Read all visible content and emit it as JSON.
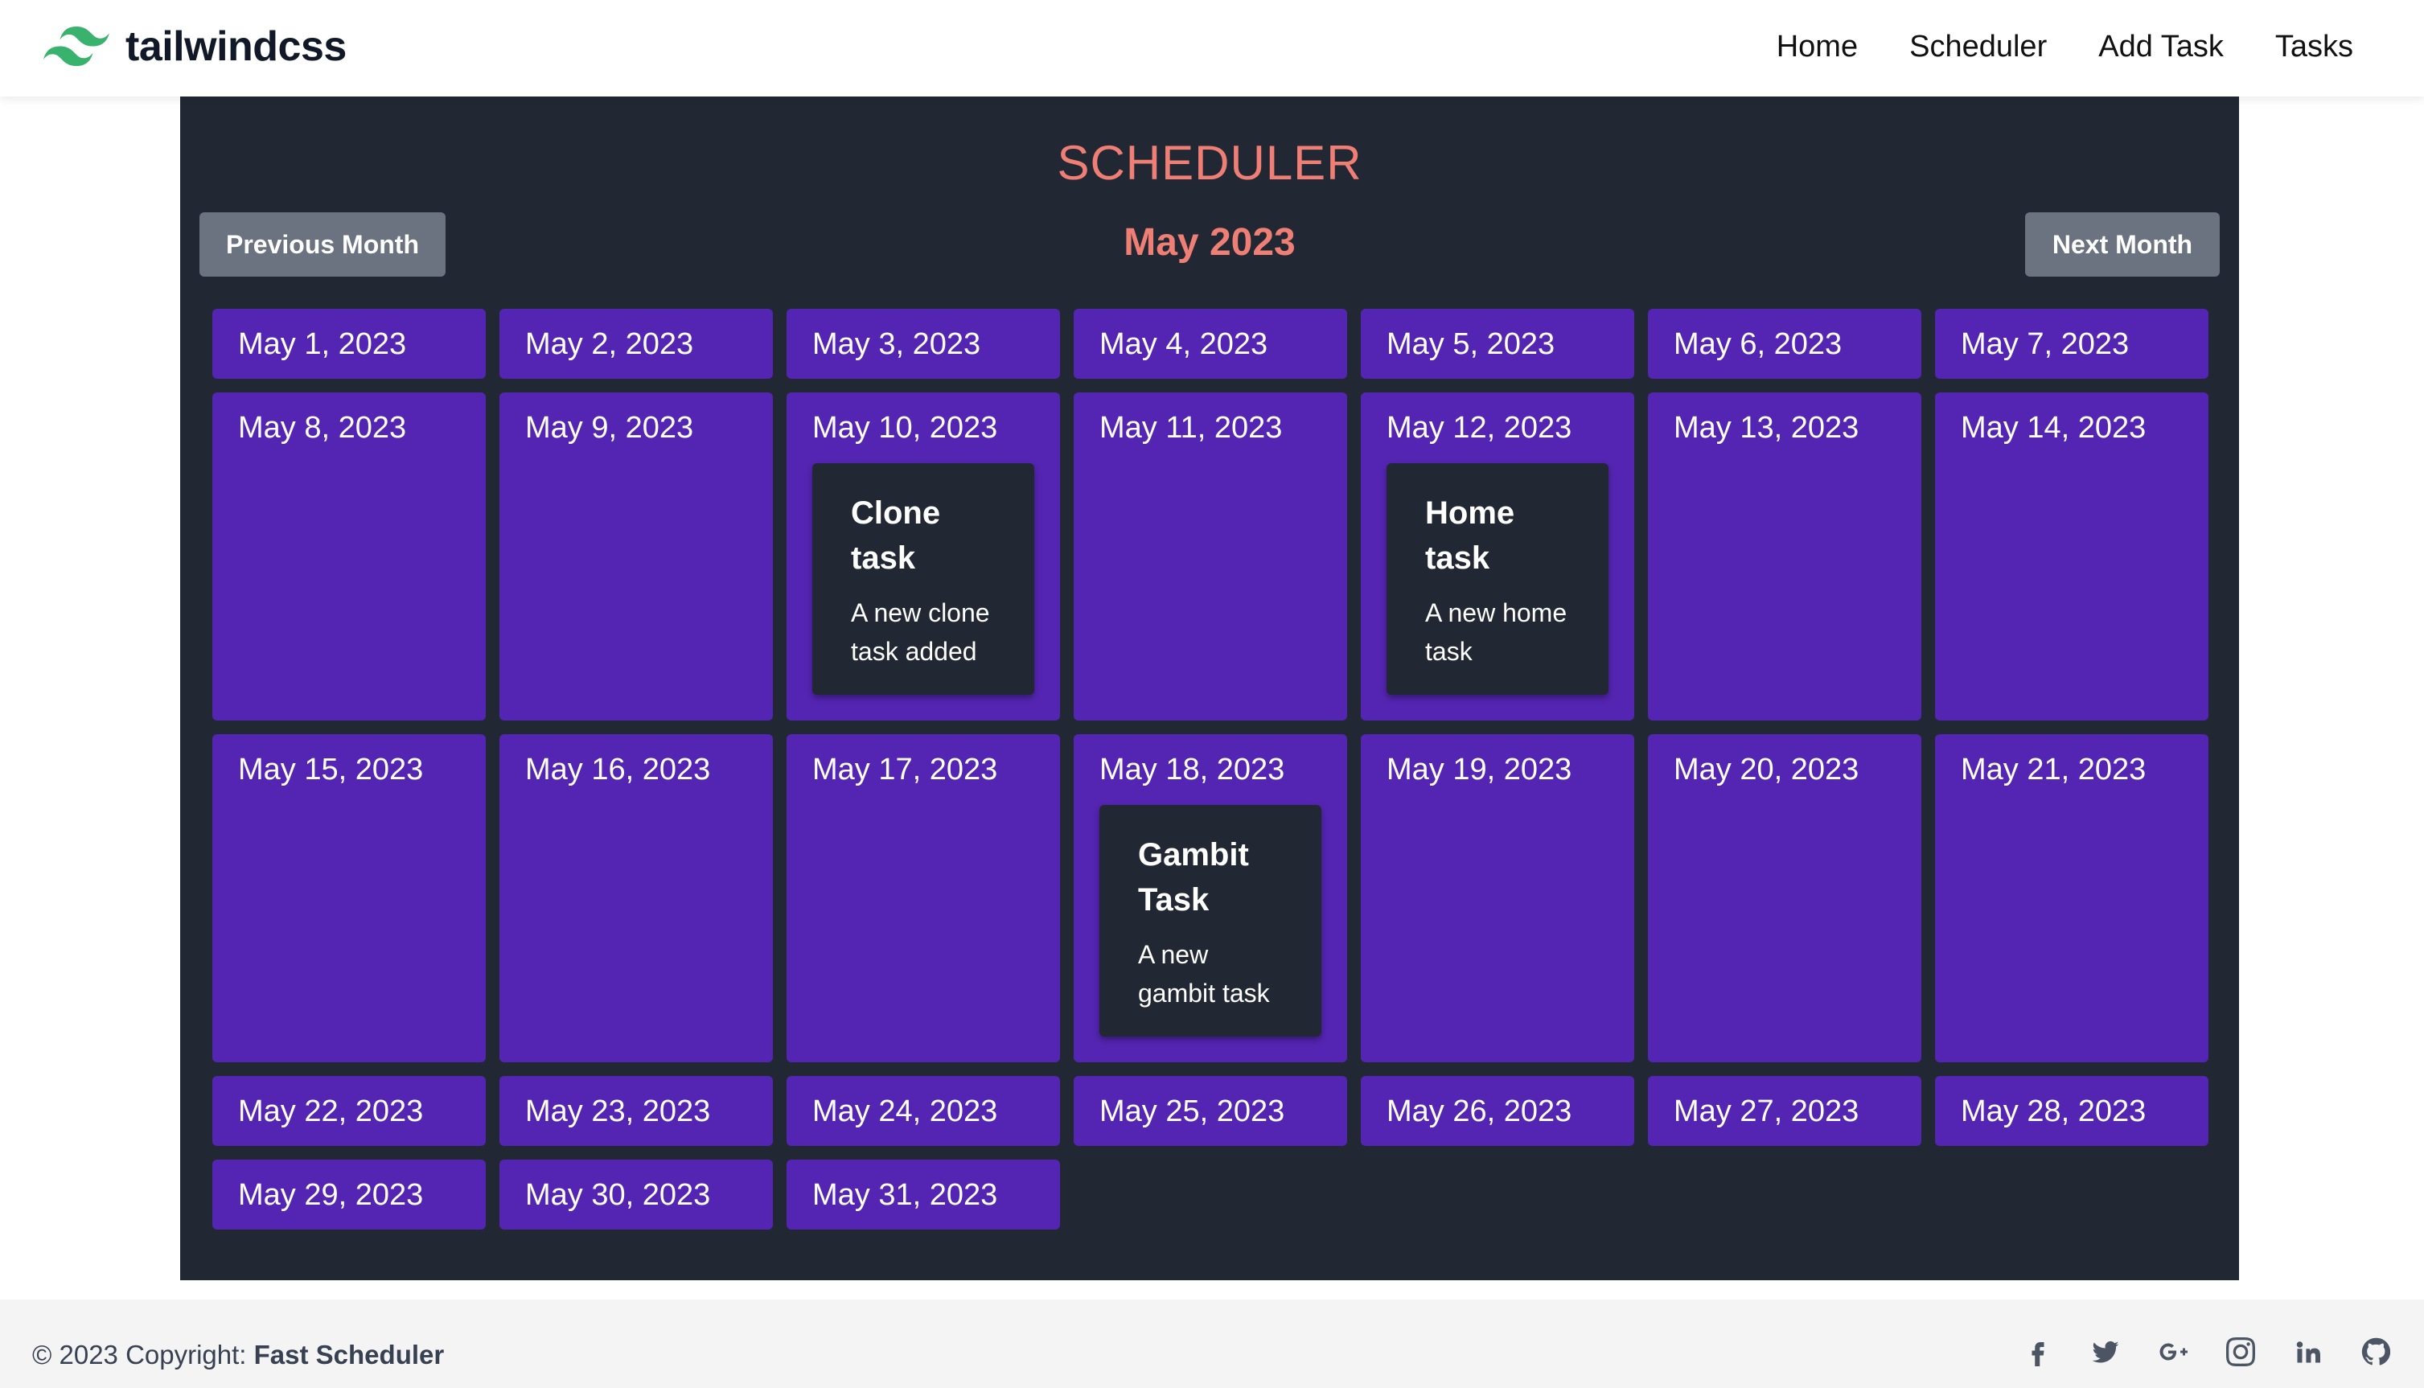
{
  "brand": {
    "name": "tailwindcss",
    "logo_color": "#38b26c"
  },
  "nav": {
    "links": [
      "Home",
      "Scheduler",
      "Add Task",
      "Tasks"
    ]
  },
  "scheduler": {
    "title": "SCHEDULER",
    "month_label": "May 2023",
    "prev_button": "Previous Month",
    "next_button": "Next Month",
    "colors": {
      "panel": "#222833",
      "day": "#5425b2",
      "accent": "#ef7f75",
      "button": "#6b7280"
    },
    "days": [
      {
        "label": "May 1, 2023"
      },
      {
        "label": "May 2, 2023"
      },
      {
        "label": "May 3, 2023"
      },
      {
        "label": "May 4, 2023"
      },
      {
        "label": "May 5, 2023"
      },
      {
        "label": "May 6, 2023"
      },
      {
        "label": "May 7, 2023"
      },
      {
        "label": "May 8, 2023"
      },
      {
        "label": "May 9, 2023"
      },
      {
        "label": "May 10, 2023",
        "task": {
          "title": "Clone task",
          "description": "A new clone task added"
        }
      },
      {
        "label": "May 11, 2023"
      },
      {
        "label": "May 12, 2023",
        "task": {
          "title": "Home task",
          "description": "A new home task"
        }
      },
      {
        "label": "May 13, 2023"
      },
      {
        "label": "May 14, 2023"
      },
      {
        "label": "May 15, 2023"
      },
      {
        "label": "May 16, 2023"
      },
      {
        "label": "May 17, 2023"
      },
      {
        "label": "May 18, 2023",
        "task": {
          "title": "Gambit Task",
          "description": "A new gambit task"
        }
      },
      {
        "label": "May 19, 2023"
      },
      {
        "label": "May 20, 2023"
      },
      {
        "label": "May 21, 2023"
      },
      {
        "label": "May 22, 2023"
      },
      {
        "label": "May 23, 2023"
      },
      {
        "label": "May 24, 2023"
      },
      {
        "label": "May 25, 2023"
      },
      {
        "label": "May 26, 2023"
      },
      {
        "label": "May 27, 2023"
      },
      {
        "label": "May 28, 2023"
      },
      {
        "label": "May 29, 2023"
      },
      {
        "label": "May 30, 2023"
      },
      {
        "label": "May 31, 2023"
      }
    ]
  },
  "footer": {
    "copyright_prefix": "© 2023 Copyright: ",
    "copyright_brand": "Fast Scheduler",
    "social_icons": [
      "facebook-icon",
      "twitter-icon",
      "google-plus-icon",
      "instagram-icon",
      "linkedin-icon",
      "github-icon"
    ]
  }
}
